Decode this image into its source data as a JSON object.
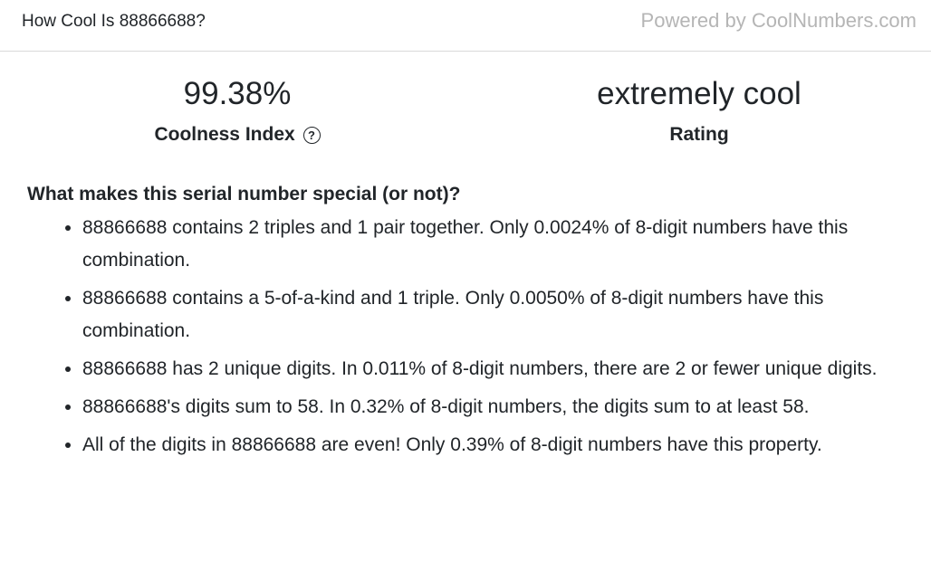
{
  "header": {
    "title": "How Cool Is 88866688?",
    "powered_by": "Powered by CoolNumbers.com"
  },
  "stats": {
    "coolness_value": "99.38%",
    "coolness_label": "Coolness Index",
    "help_glyph": "?",
    "rating_value": "extremely cool",
    "rating_label": "Rating"
  },
  "section": {
    "heading": "What makes this serial number special (or not)?",
    "items": [
      "88866688 contains 2 triples and 1 pair together. Only 0.0024% of 8-digit numbers have this combination.",
      "88866688 contains a 5-of-a-kind and 1 triple. Only 0.0050% of 8-digit numbers have this combination.",
      "88866688 has 2 unique digits. In 0.011% of 8-digit numbers, there are 2 or fewer unique digits.",
      "88866688's digits sum to 58. In 0.32% of 8-digit numbers, the digits sum to at least 58.",
      "All of the digits in 88866688 are even! Only 0.39% of 8-digit numbers have this property."
    ]
  },
  "icons": {
    "help": "question-circle-icon"
  }
}
